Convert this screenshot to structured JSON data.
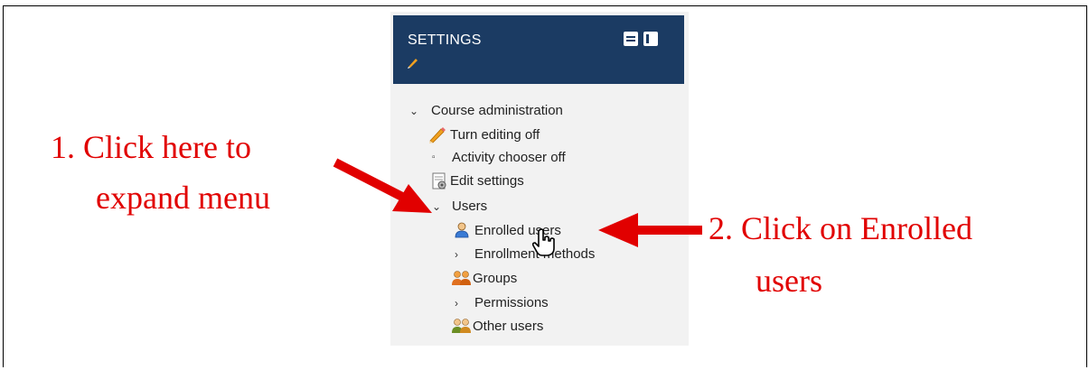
{
  "settings": {
    "title": "SETTINGS",
    "tree": {
      "course_admin": "Course administration",
      "turn_editing": "Turn editing off",
      "activity_chooser": "Activity chooser off",
      "edit_settings": "Edit settings",
      "users": "Users",
      "enrolled_users": "Enrolled users",
      "enrollment_methods": "Enrollment methods",
      "groups": "Groups",
      "permissions": "Permissions",
      "other_users": "Other users"
    }
  },
  "annotations": {
    "step1_line1": "1. Click here to",
    "step1_line2": "expand menu",
    "step2_line1": "2. Click on Enrolled",
    "step2_line2": "users"
  },
  "colors": {
    "header_bg": "#1b3b63",
    "annotation_red": "#e10000",
    "block_bg": "#f2f2f2"
  },
  "icons": [
    "pencil-icon",
    "edit-settings-icon",
    "user-icon",
    "groups-icon",
    "other-users-icon",
    "hand-cursor-icon"
  ]
}
